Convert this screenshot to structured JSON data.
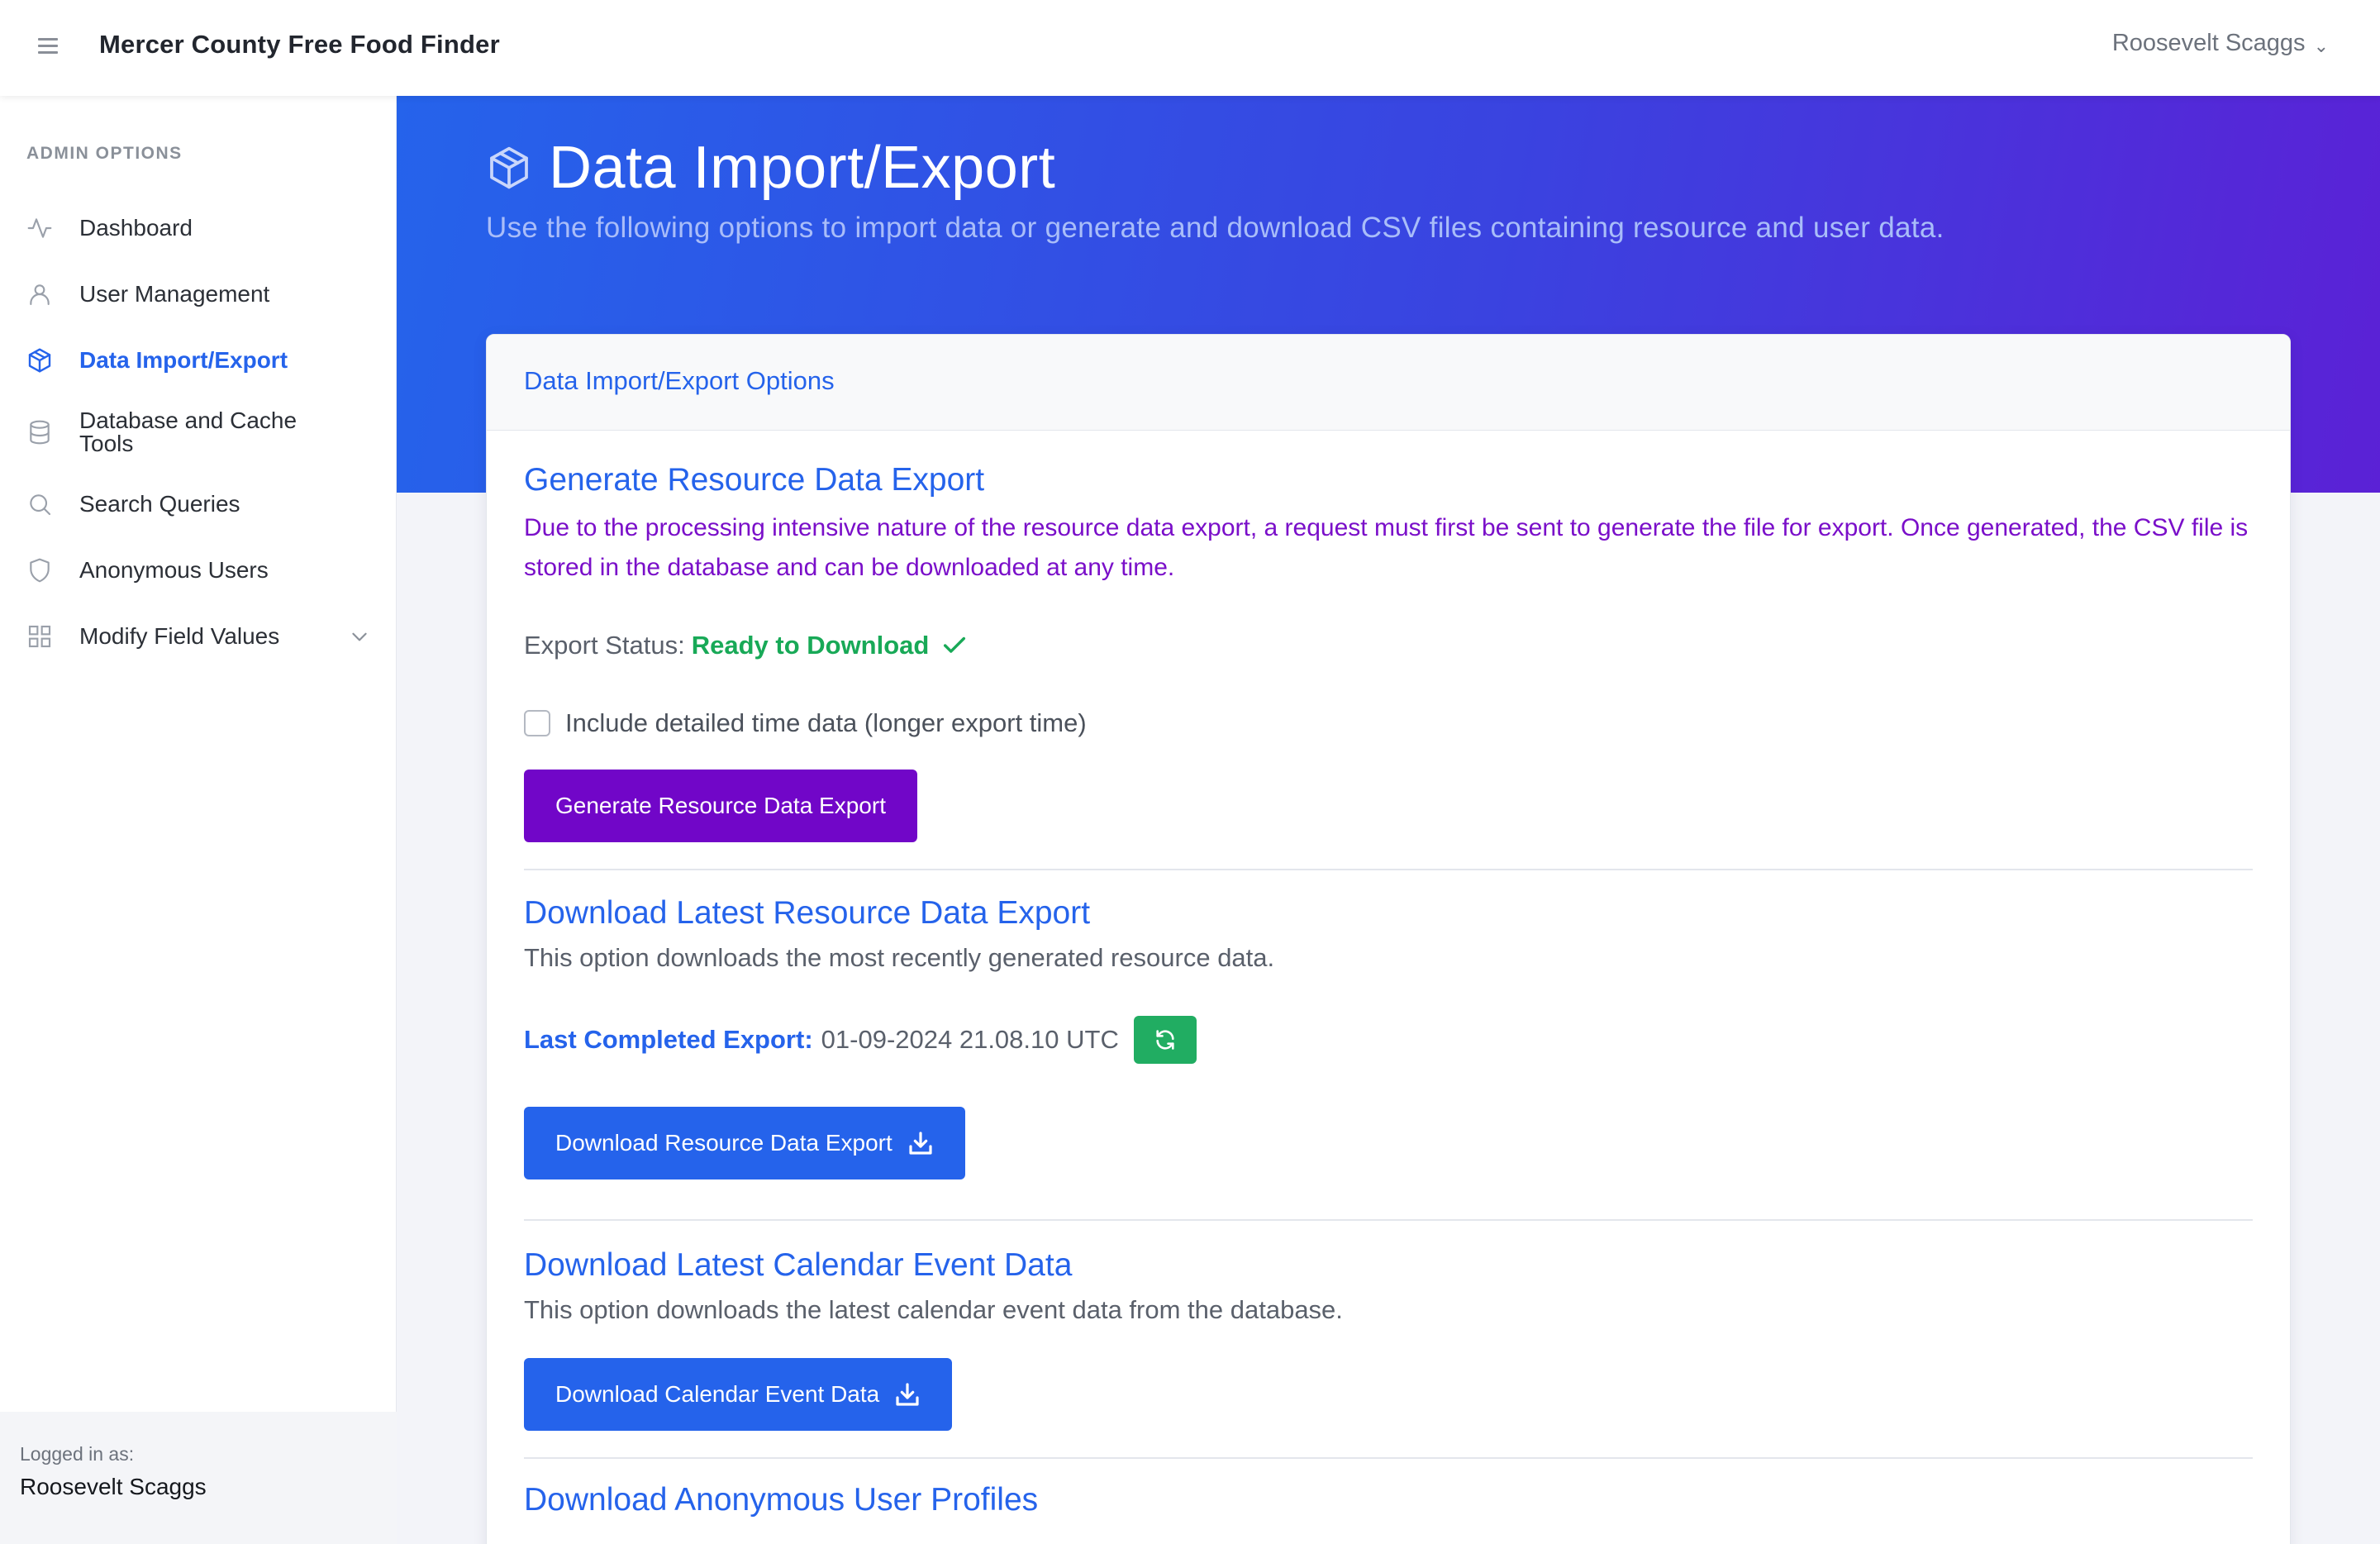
{
  "app": {
    "brand": "Mercer County Free Food Finder"
  },
  "user_menu": {
    "name": "Roosevelt Scaggs"
  },
  "sidebar": {
    "heading": "ADMIN OPTIONS",
    "items": [
      {
        "label": "Dashboard",
        "icon": "activity-icon"
      },
      {
        "label": "User Management",
        "icon": "user-icon"
      },
      {
        "label": "Data Import/Export",
        "icon": "box-icon",
        "active": true
      },
      {
        "label": "Database and Cache Tools",
        "icon": "database-icon"
      },
      {
        "label": "Search Queries",
        "icon": "search-icon"
      },
      {
        "label": "Anonymous Users",
        "icon": "shield-icon"
      },
      {
        "label": "Modify Field Values",
        "icon": "grid-icon"
      }
    ],
    "footer": {
      "label": "Logged in as:",
      "user": "Roosevelt Scaggs"
    }
  },
  "hero": {
    "title": "Data Import/Export",
    "subtitle": "Use the following options to import data or generate and download CSV files containing resource and user data."
  },
  "card": {
    "header": "Data Import/Export Options",
    "generate": {
      "title": "Generate Resource Data Export",
      "description": "Due to the processing intensive nature of the resource data export, a request must first be sent to generate the file for export. Once generated, the CSV file is stored in the database and can be downloaded at any time.",
      "status_label": "Export Status:",
      "status_value": "Ready to Download",
      "checkbox_label": "Include detailed time data (longer export time)",
      "checkbox_checked": false,
      "button": "Generate Resource Data Export"
    },
    "download_resource": {
      "title": "Download Latest Resource Data Export",
      "description": "This option downloads the most recently generated resource data.",
      "last_label": "Last Completed Export:",
      "last_value": "01-09-2024 21.08.10 UTC",
      "button": "Download Resource Data Export"
    },
    "download_calendar": {
      "title": "Download Latest Calendar Event Data",
      "description": "This option downloads the latest calendar event data from the database.",
      "button": "Download Calendar Event Data"
    },
    "download_anonymous": {
      "title": "Download Anonymous User Profiles"
    }
  },
  "colors": {
    "primary": "#2563eb",
    "purple": "#7106c8",
    "success": "#21ad62",
    "hero_start": "#2563eb",
    "hero_end": "#5b21d6"
  }
}
